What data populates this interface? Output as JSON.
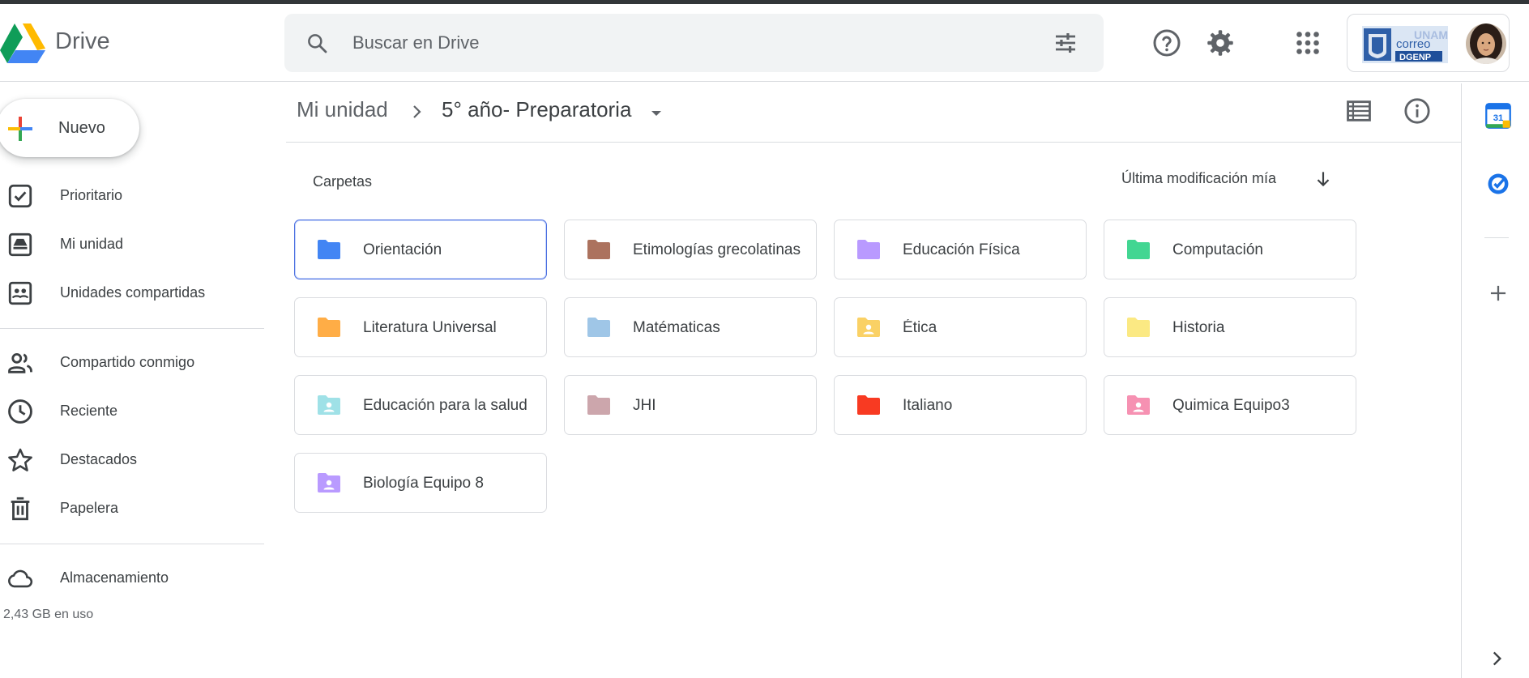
{
  "app": {
    "name": "Drive"
  },
  "search": {
    "placeholder": "Buscar en Drive"
  },
  "sidebar": {
    "new_label": "Nuevo",
    "items": [
      {
        "label": "Prioritario",
        "icon": "priority-icon"
      },
      {
        "label": "Mi unidad",
        "icon": "my-drive-icon"
      },
      {
        "label": "Unidades compartidas",
        "icon": "shared-drives-icon"
      },
      {
        "label": "Compartido conmigo",
        "icon": "people-icon"
      },
      {
        "label": "Reciente",
        "icon": "clock-icon"
      },
      {
        "label": "Destacados",
        "icon": "star-icon"
      },
      {
        "label": "Papelera",
        "icon": "trash-icon"
      }
    ],
    "storage": {
      "label": "Almacenamiento",
      "usage": "2,43 GB en uso"
    }
  },
  "breadcrumb": {
    "root": "Mi unidad",
    "current": "5° año- Preparatoria"
  },
  "main": {
    "section_title": "Carpetas",
    "sort_label": "Última modificación mía",
    "folders": [
      {
        "name": "Orientación",
        "color": "#4285f4",
        "shared": false,
        "selected": true
      },
      {
        "name": "Etimologías grecolatinas",
        "color": "#ac725e",
        "shared": false
      },
      {
        "name": "Educación Física",
        "color": "#b99aff",
        "shared": false
      },
      {
        "name": "Computación",
        "color": "#42d692",
        "shared": false
      },
      {
        "name": "Literatura Universal",
        "color": "#ffad46",
        "shared": false
      },
      {
        "name": "Matématicas",
        "color": "#9fc6e7",
        "shared": false
      },
      {
        "name": "Ética",
        "color": "#fad165",
        "shared": true
      },
      {
        "name": "Historia",
        "color": "#fbe983",
        "shared": false
      },
      {
        "name": "Educación para la salud",
        "color": "#9fe1e7",
        "shared": true
      },
      {
        "name": "JHI",
        "color": "#cca6ac",
        "shared": false
      },
      {
        "name": "Italiano",
        "color": "#f83a22",
        "shared": false
      },
      {
        "name": "Quimica Equipo3",
        "color": "#f691b2",
        "shared": true
      },
      {
        "name": "Biología Equipo 8",
        "color": "#b99aff",
        "shared": true
      }
    ]
  },
  "account": {
    "logo_text_top": "UNAM",
    "logo_text_mid": "correo",
    "logo_text_bottom": "DGENP"
  },
  "calendar": {
    "day": "31"
  },
  "colors": {
    "accent": "#1a73e8",
    "text": "#3c4043",
    "icon": "#5f6368",
    "border": "#dadce0"
  }
}
